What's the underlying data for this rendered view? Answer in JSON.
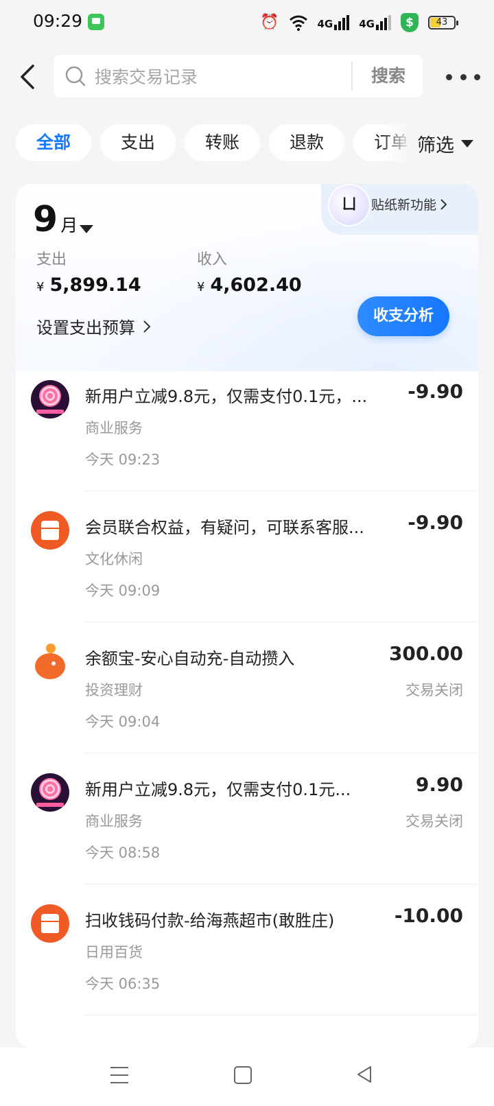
{
  "status_bar": {
    "time": "09:29",
    "signal_1": "4G",
    "signal_2": "4G",
    "battery": "43",
    "battery_level": 0.43
  },
  "header": {
    "search_placeholder": "搜索交易记录",
    "search_button": "搜索"
  },
  "filters": {
    "chips": [
      "全部",
      "支出",
      "转账",
      "退款",
      "订单"
    ],
    "active_index": 0,
    "filter_label": "筛选"
  },
  "summary": {
    "sticker_label": "贴纸新功能",
    "month_number": "9",
    "month_unit": "月",
    "expense_label": "支出",
    "expense_currency": "¥",
    "expense_value": "5,899.14",
    "income_label": "收入",
    "income_currency": "¥",
    "income_value": "4,602.40",
    "budget_label": "设置支出预算",
    "analysis_button": "收支分析"
  },
  "transactions": [
    {
      "icon": "lollipop-app-icon",
      "title": "新用户立减9.8元，仅需支付0.1元，...",
      "category": "商业服务",
      "time": "今天 09:23",
      "amount": "-9.90",
      "status": ""
    },
    {
      "icon": "shop-icon",
      "title": "会员联合权益，有疑问，可联系客服...",
      "category": "文化休闲",
      "time": "今天 09:09",
      "amount": "-9.90",
      "status": ""
    },
    {
      "icon": "yuebao-whale-icon",
      "title": "余额宝-安心自动充-自动攒入",
      "category": "投资理财",
      "time": "今天 09:04",
      "amount": "300.00",
      "status": "交易关闭"
    },
    {
      "icon": "lollipop-app-icon",
      "title": "新用户立减9.8元，仅需支付0.1元...",
      "category": "商业服务",
      "time": "今天 08:58",
      "amount": "9.90",
      "status": "交易关闭"
    },
    {
      "icon": "shop-icon",
      "title": "扫收钱码付款-给海燕超市(敢胜庄)",
      "category": "日用百货",
      "time": "今天 06:35",
      "amount": "-10.00",
      "status": ""
    }
  ],
  "colors": {
    "accent": "#1677ff",
    "background": "#f5f5f5",
    "shop_icon": "#f05a24"
  }
}
